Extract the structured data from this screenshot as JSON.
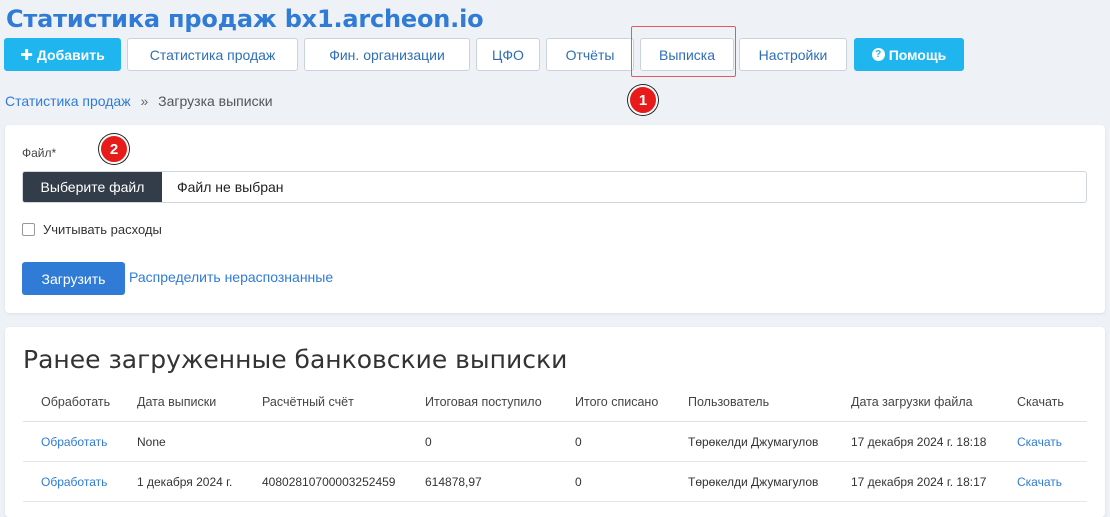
{
  "page": {
    "title": "Статистика продаж bx1.archeon.io"
  },
  "toolbar": {
    "add": "Добавить",
    "sales_stats": "Статистика продаж",
    "fin_orgs": "Фин. организации",
    "cfo": "ЦФО",
    "reports": "Отчёты",
    "statement": "Выписка",
    "settings": "Настройки",
    "help": "Помощь"
  },
  "markers": {
    "one": "1",
    "two": "2"
  },
  "breadcrumb": {
    "parent": "Статистика продаж",
    "separator": "»",
    "current": "Загрузка выписки"
  },
  "upload_form": {
    "file_label": "Файл*",
    "choose_file": "Выберите файл",
    "no_file": "Файл не выбран",
    "consider_expenses": "Учитывать расходы",
    "upload_button": "Загрузить",
    "distribute_link": "Распределить нераспознанные"
  },
  "statements": {
    "title": "Ранее загруженные банковские выписки",
    "columns": [
      "Обработать",
      "Дата выписки",
      "Расчётный счёт",
      "Итоговая поступило",
      "Итого списано",
      "Пользователь",
      "Дата загрузки файла",
      "Скачать"
    ],
    "rows": [
      {
        "process": "Обработать",
        "date": "None",
        "account": "",
        "income": "0",
        "written_off": "0",
        "user": "Төрөкелди Джумагулов",
        "upload_date": "17 декабря 2024 г. 18:18",
        "download": "Скачать"
      },
      {
        "process": "Обработать",
        "date": "1 декабря 2024 г.",
        "account": "40802810700003252459",
        "income": "614878,97",
        "written_off": "0",
        "user": "Төрөкелди Джумагулов",
        "upload_date": "17 декабря 2024 г. 18:17",
        "download": "Скачать"
      }
    ]
  },
  "colors": {
    "accent": "#2f7bd6",
    "cyan": "#1fb6f0",
    "marker": "#e81b1b",
    "dark_button": "#333c49"
  }
}
